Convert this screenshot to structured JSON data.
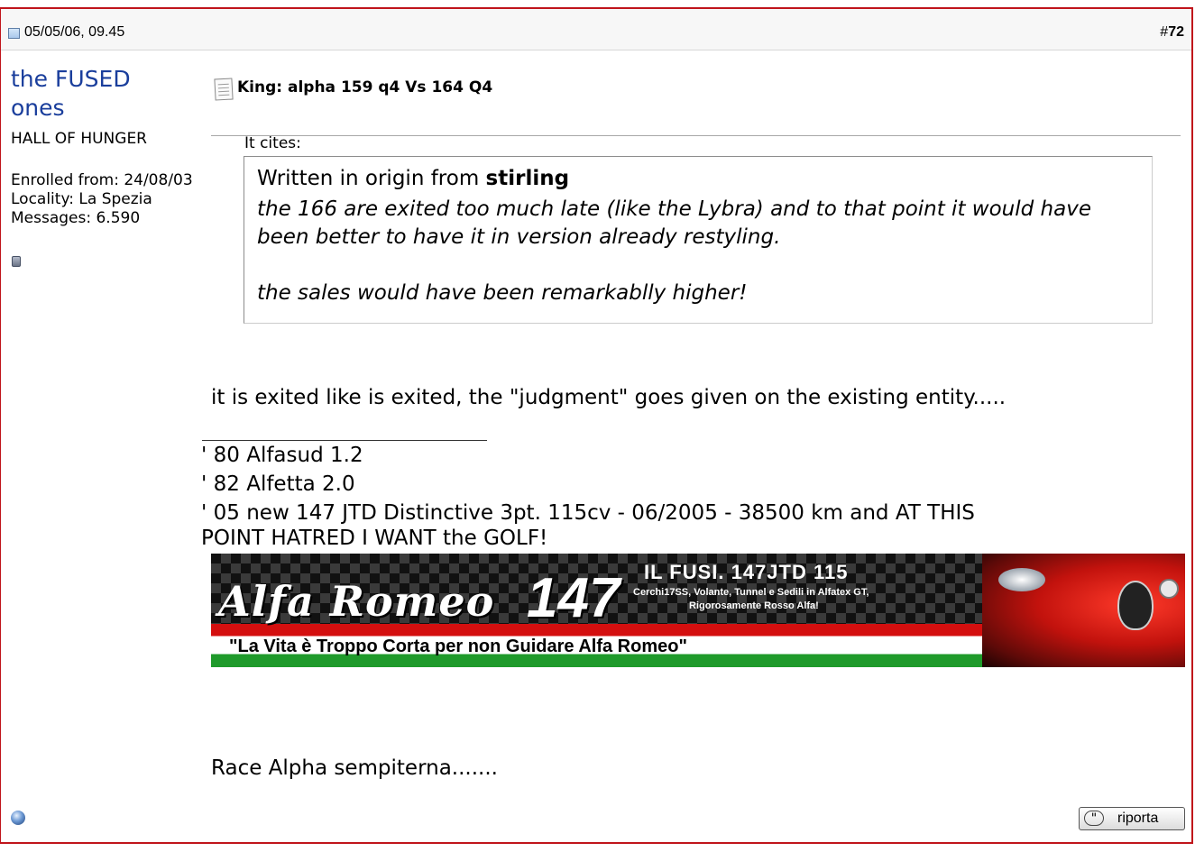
{
  "header": {
    "date": "05/05/06, 09.45",
    "post_number_prefix": "#",
    "post_number": "72"
  },
  "user": {
    "name": "the FUSED ones",
    "title": "HALL OF HUNGER",
    "enrolled": "Enrolled from: 24/08/03",
    "locality": "Locality: La Spezia",
    "messages": "Messages: 6.590"
  },
  "post": {
    "title": "King: alpha 159 q4 Vs 164 Q4",
    "quote_label": "It cites:",
    "quote_source_prefix": "Written in origin from",
    "quote_author": "stirling",
    "quote_text": "the 166 are exited too much late (like the Lybra) and to that point it would have been better to have it in version already restyling.",
    "quote_text2": "the sales would have been remarkablly higher!",
    "body": "it is exited like is exited, the \"judgment\" goes given on the existing entity.....",
    "closing": "Race Alpha sempiterna......."
  },
  "signature": {
    "lines": [
      "' 80 Alfasud 1.2",
      "' 82 Alfetta 2.0",
      "' 05 new 147 JTD Distinctive 3pt. 115cv - 06/2005 - 38500 km and AT THIS",
      "POINT HATRED I WANT the GOLF!"
    ],
    "banner": {
      "brand": "Alfa Romeo",
      "model": "147",
      "line1": "IL FUSI. 147JTD 115",
      "line2": "Cerchi17SS, Volante, Tunnel e Sedili in Alfatex GT,",
      "line3": "Rigorosamente Rosso Alfa!",
      "motto": "\"La Vita è Troppo Corta per non Guidare Alfa Romeo\""
    }
  },
  "actions": {
    "report_label": "riporta",
    "report_icon": "quote-bubble-icon"
  },
  "colors": {
    "border": "#c0151b",
    "username": "#1a3e9c"
  }
}
